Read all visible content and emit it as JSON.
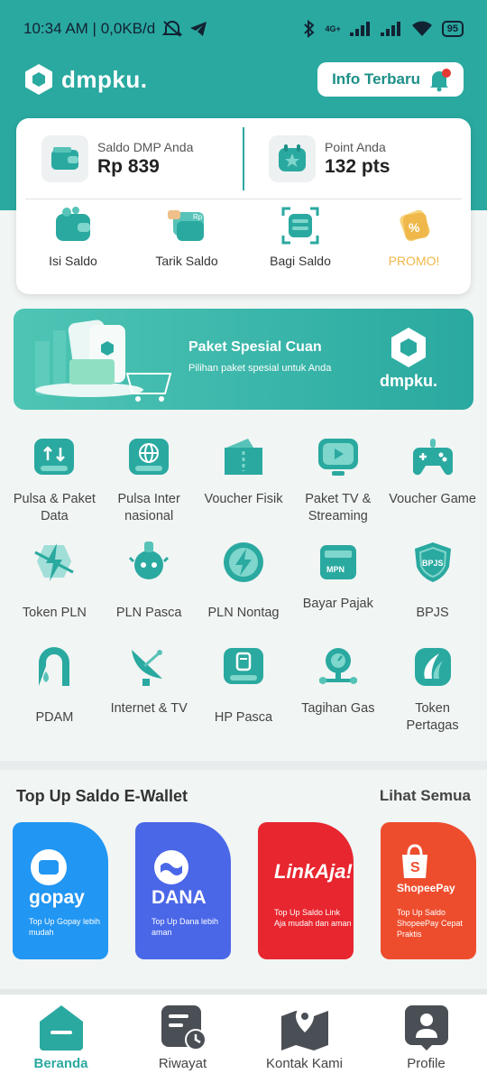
{
  "status": {
    "time_net": "10:34 AM | 0,0KB/d",
    "battery": "95",
    "net": "4G+"
  },
  "header": {
    "logo_text": "dmpku.",
    "info_button": "Info Terbaru"
  },
  "balances": {
    "saldo_label": "Saldo DMP Anda",
    "saldo_value": "Rp 839",
    "point_label": "Point Anda",
    "point_value": "132 pts"
  },
  "actions": [
    {
      "label": "Isi Saldo",
      "icon": "wallet-icon"
    },
    {
      "label": "Tarik Saldo",
      "icon": "withdraw-icon"
    },
    {
      "label": "Bagi Saldo",
      "icon": "share-balance-icon"
    },
    {
      "label": "PROMO!",
      "icon": "promo-tag-icon"
    }
  ],
  "banner": {
    "title": "Paket Spesial Cuan",
    "subtitle": "Pilihan paket spesial untuk Anda",
    "logo_text": "dmpku."
  },
  "services": [
    [
      {
        "label": "Pulsa & Paket Data",
        "icon": "phone-data-icon"
      },
      {
        "label": "Pulsa Inter nasional",
        "icon": "globe-icon"
      },
      {
        "label": "Voucher Fisik",
        "icon": "voucher-icon"
      },
      {
        "label": "Paket TV & Streaming",
        "icon": "tv-icon"
      },
      {
        "label": "Voucher Game",
        "icon": "gamepad-icon"
      }
    ],
    [
      {
        "label": "Token PLN",
        "icon": "electric-token-icon"
      },
      {
        "label": "PLN Pasca",
        "icon": "plug-icon"
      },
      {
        "label": "PLN Nontag",
        "icon": "lightning-icon"
      },
      {
        "label": "Bayar Pajak",
        "icon": "tax-card-icon"
      },
      {
        "label": "BPJS",
        "icon": "bpjs-shield-icon"
      }
    ],
    [
      {
        "label": "PDAM",
        "icon": "water-tap-icon"
      },
      {
        "label": "Internet & TV",
        "icon": "satellite-icon"
      },
      {
        "label": "HP Pasca",
        "icon": "mobile-bill-icon"
      },
      {
        "label": "Tagihan Gas",
        "icon": "gas-meter-icon"
      },
      {
        "label": "Token Pertagas",
        "icon": "pertagas-icon"
      }
    ]
  ],
  "ewallet": {
    "title": "Top Up Saldo E-Wallet",
    "more": "Lihat Semua",
    "cards": [
      {
        "brand": "gopay",
        "desc": "Top Up Gopay lebih mudah",
        "color": "#2196f3"
      },
      {
        "brand": "DANA",
        "desc": "Top Up Dana lebih aman",
        "color": "#4a67e8"
      },
      {
        "brand": "LinkAja!",
        "desc": "Top Up Saldo Link Aja mudah dan aman",
        "color": "#e8262f"
      },
      {
        "brand": "ShopeePay",
        "desc": "Top Up Saldo ShopeePay Cepat Praktis",
        "color": "#ee4d2d"
      }
    ]
  },
  "nav": [
    {
      "label": "Beranda",
      "icon": "home-icon",
      "active": true
    },
    {
      "label": "Riwayat",
      "icon": "history-icon"
    },
    {
      "label": "Kontak Kami",
      "icon": "map-contact-icon"
    },
    {
      "label": "Profile",
      "icon": "profile-icon"
    }
  ],
  "colors": {
    "primary": "#2aa9a0",
    "promo": "#f0b84a"
  }
}
